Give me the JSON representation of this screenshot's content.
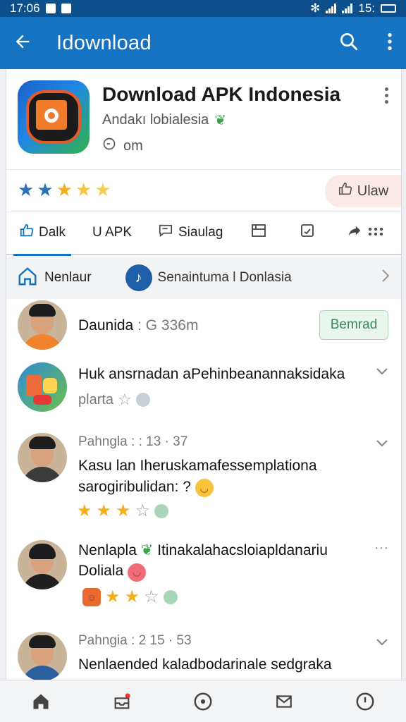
{
  "status_bar": {
    "time": "17:06",
    "clock_right": "15:"
  },
  "app_bar": {
    "title": "Idownload",
    "back_icon": "back-arrow-icon",
    "search_icon": "search-icon",
    "menu_icon": "more-vert-icon"
  },
  "app": {
    "title": "Download APK Indonesia",
    "subtitle": "Andakı lobialesia",
    "meta": "om",
    "rating_stars": 5,
    "action_label": "Ulaw"
  },
  "tabs": [
    {
      "label": "Dalk",
      "icon": "thumbs-up-icon"
    },
    {
      "label": "U APK",
      "icon": ""
    },
    {
      "label": "Siaulag",
      "icon": "chat-icon"
    },
    {
      "label": "",
      "icon": "gallery-icon"
    },
    {
      "label": "",
      "icon": "calendar-icon"
    },
    {
      "label": "",
      "icon": "share-icon"
    }
  ],
  "filter": {
    "home_label": "Nenlaur",
    "source_label": "Senaintuma l Donlasia"
  },
  "items": [
    {
      "name": "Daunida",
      "meta": ": G 336m",
      "button": "Bemrad"
    },
    {
      "text": "Huk ansrnadan aPehinbeanannaksidaka",
      "sub": "plarta"
    },
    {
      "meta": "Pahngla : : 13 · 37",
      "text": "Kasu lan Iheruskamafessemplationa sarogiribulidan: ?",
      "rating": 3
    },
    {
      "title": "Nenlapla",
      "title_rest": "Itinakalahacsloiapldanariu",
      "line2": "Doliala",
      "rating": 2
    },
    {
      "meta": "Pahngia : 2 15 · 53",
      "text": "Nenlaended kaladbodarinale sedgraka"
    }
  ],
  "bottom_nav": [
    "home-icon",
    "inbox-icon",
    "compass-icon",
    "mail-icon",
    "clock-icon"
  ],
  "colors": {
    "primary": "#1673c2",
    "status": "#0c4f8a",
    "star": "#f2b01e"
  }
}
